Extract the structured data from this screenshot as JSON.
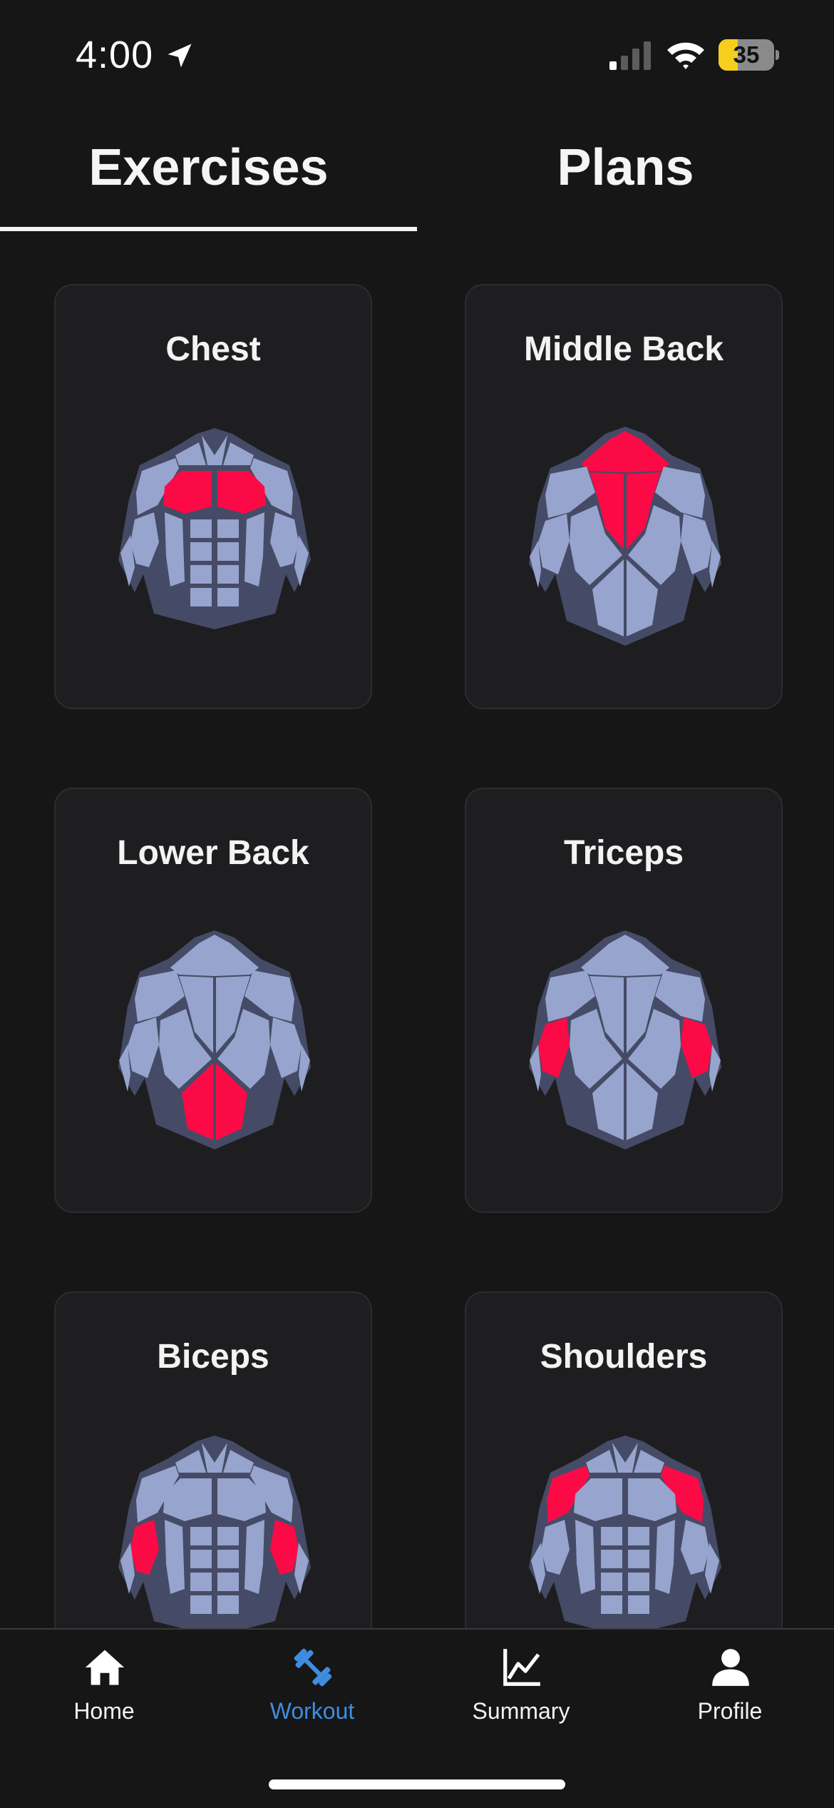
{
  "status_bar": {
    "time": "4:00",
    "battery": "35",
    "battery_level": 0.35
  },
  "tabs": [
    {
      "label": "Exercises",
      "active": true
    },
    {
      "label": "Plans",
      "active": false
    }
  ],
  "muscle_groups": [
    {
      "label": "Chest",
      "view": "front",
      "highlight": "chest"
    },
    {
      "label": "Middle Back",
      "view": "back",
      "highlight": "middle-back"
    },
    {
      "label": "Lower Back",
      "view": "back",
      "highlight": "lower-back"
    },
    {
      "label": "Triceps",
      "view": "back",
      "highlight": "triceps"
    },
    {
      "label": "Biceps",
      "view": "front",
      "highlight": "biceps"
    },
    {
      "label": "Shoulders",
      "view": "front",
      "highlight": "shoulders"
    }
  ],
  "colors": {
    "background": "#161617",
    "card": "#1e1e20",
    "muscle": "#97a4cd",
    "outline": "#454b66",
    "highlight": "#fb0a46",
    "accent": "#3d8ee0"
  },
  "nav": [
    {
      "label": "Home",
      "icon": "home-icon",
      "active": false
    },
    {
      "label": "Workout",
      "icon": "dumbbell-icon",
      "active": true
    },
    {
      "label": "Summary",
      "icon": "chart-icon",
      "active": false
    },
    {
      "label": "Profile",
      "icon": "person-icon",
      "active": false
    }
  ]
}
